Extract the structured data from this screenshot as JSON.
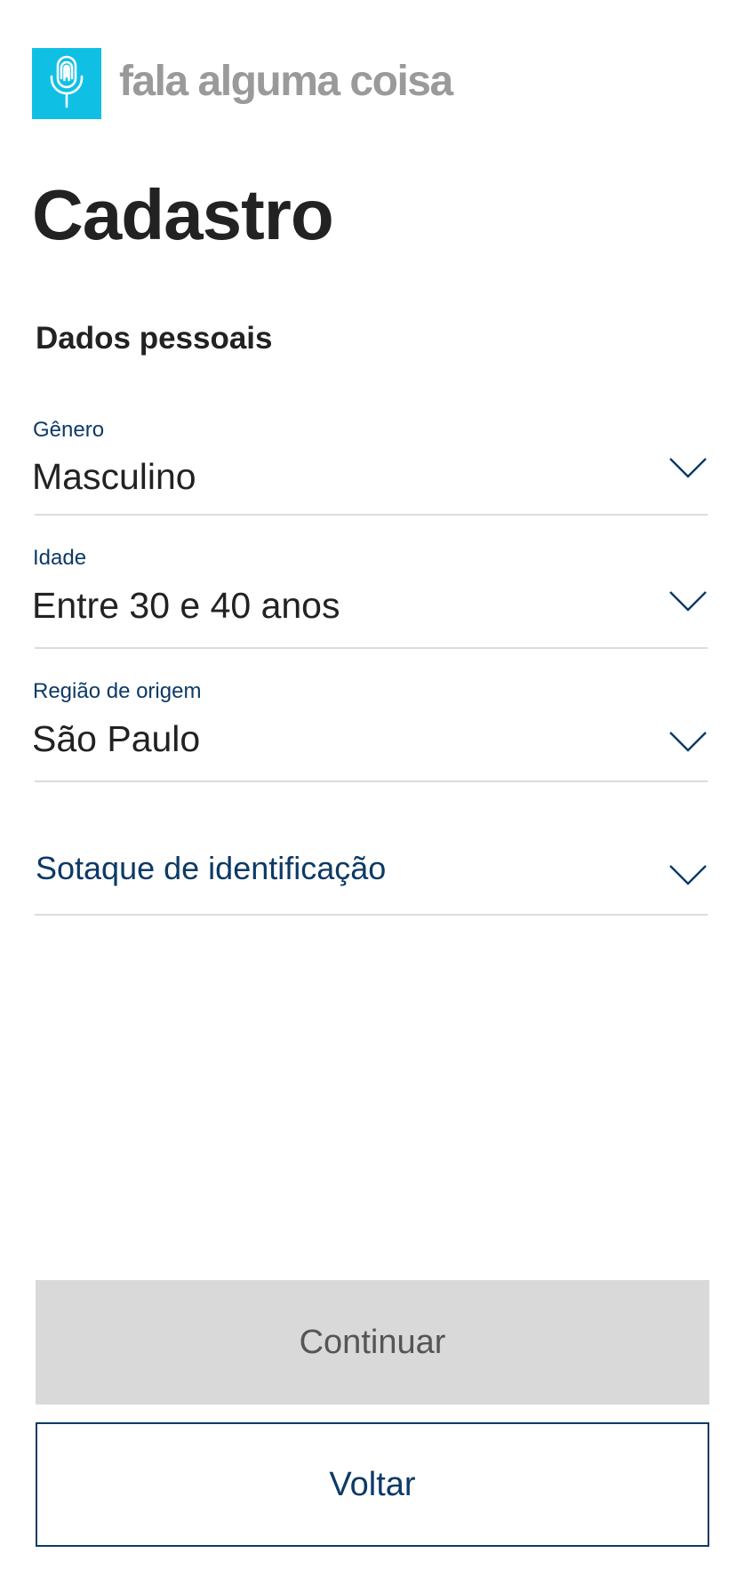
{
  "brand": {
    "logo_icon": "microphone-fingerprint-icon",
    "name": "fala alguma coisa",
    "accent_color": "#10c0e4"
  },
  "page": {
    "title": "Cadastro",
    "section_title": "Dados pessoais"
  },
  "form": {
    "gender": {
      "label": "Gênero",
      "value": "Masculino"
    },
    "age": {
      "label": "Idade",
      "value": "Entre 30 e 40 anos"
    },
    "region": {
      "label": "Região de origem",
      "value": "São Paulo"
    },
    "accent": {
      "placeholder": "Sotaque de identificação"
    }
  },
  "actions": {
    "continue_label": "Continuar",
    "back_label": "Voltar"
  },
  "colors": {
    "label_blue": "#0d3a66",
    "disabled_button": "#d9d9d9"
  }
}
